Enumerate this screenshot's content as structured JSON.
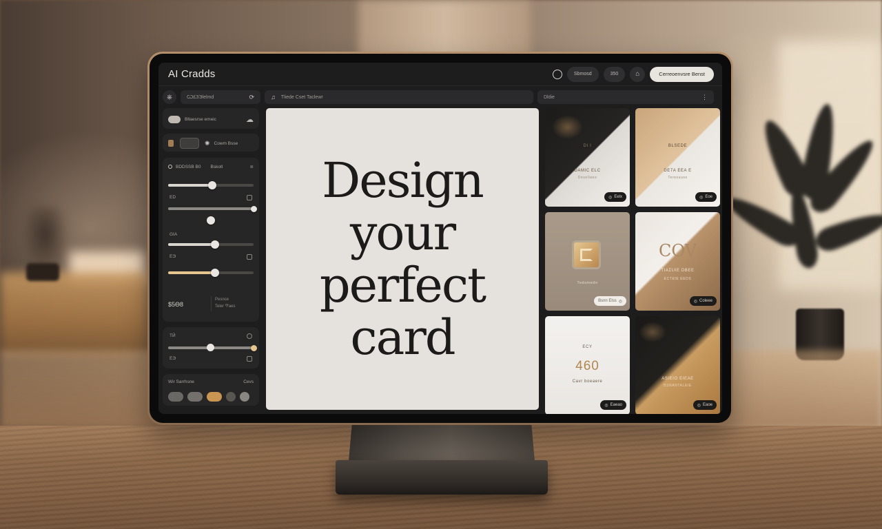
{
  "app": {
    "title": "AI Cradds"
  },
  "topbar": {
    "pill_1": "Sbmosd",
    "pill_2": "350",
    "cta": "Cerreoenvsre Benst"
  },
  "search": {
    "left_icon": "⎈",
    "left_placeholder": "Ѡ£ЗЭlelmd",
    "left_icon_right": "⟳",
    "mid_icon": "♫",
    "mid_text": "Tliede Cset Taclewr",
    "right_text": "Dldie",
    "right_dots": "⋮"
  },
  "sidebar": {
    "profile_label": "Bllaesrse emeic",
    "profile_icon_right": "☁",
    "tools_label": "Cowm Bsse",
    "adjust_title": "BDDSSB B0",
    "adjust_tag": "Bskotl",
    "label_1": "ED",
    "label_2": "GIA",
    "label_3": "ЕЭ",
    "price": "$5Ѳ8",
    "price_note_1": "Pesnce",
    "price_note_2": "Teler Ͳaes",
    "label_4": "ТӢ",
    "label_5": "ЕЭ",
    "palette_title": "Wir Sarrhsne",
    "palette_tag": "Cevs",
    "slider_levels": [
      0.52,
      1.0,
      0.5,
      0.55,
      0.55,
      1.0
    ],
    "swatches": [
      "#6a6865",
      "#74706b",
      "#c89553",
      "#595652",
      "#8a8782"
    ]
  },
  "canvas": {
    "headline": "Design\nyour\nperfect\ncard"
  },
  "gallery": {
    "header": "Dlde",
    "cards": [
      {
        "t1": "DI I",
        "t2": "DAMIC ELC",
        "t3": "Desellaeo",
        "btn": "Eelx"
      },
      {
        "t1": "BLSEDE",
        "t2": "DE7A EEA E",
        "t3": "Teresuuss",
        "btn": "Eoe"
      },
      {
        "t1": "",
        "t2": "",
        "t3": "Tedsmedo",
        "btn": "Bsnn Elss"
      },
      {
        "t1": "COV",
        "t2": "ΤΙΑΣUIE DBΕΕ",
        "t3": "ECTEIE EEDS",
        "btn": "Coleee"
      },
      {
        "t1": "ECY",
        "t2": "460",
        "t3": "Cavr boeaere",
        "btn": "Eaeao"
      },
      {
        "t1": "",
        "t2": "ASIEIO EIEAE",
        "t3": "BSNANTALEIE",
        "btn": "Eaoe"
      }
    ]
  }
}
